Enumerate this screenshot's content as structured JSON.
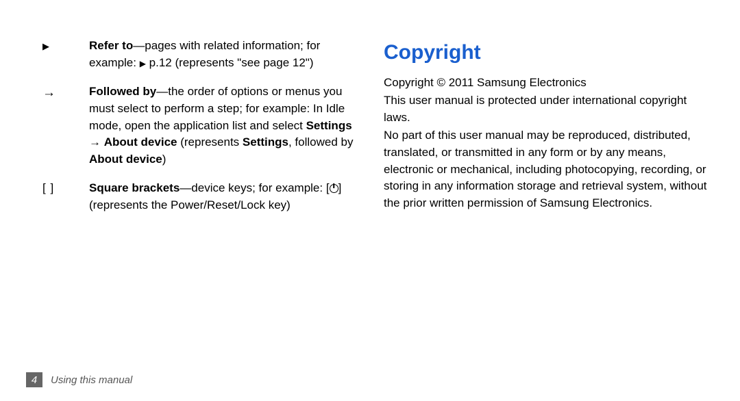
{
  "left": {
    "items": [
      {
        "symbol_type": "triangle",
        "term": "Refer to",
        "tail1": "—pages with related information; for example: ",
        "tail2": " p.12 (represents \"see page 12\")"
      },
      {
        "symbol_type": "arrow",
        "symbol": "→",
        "term": "Followed by",
        "tail1": "—the order of options or menus you must select to perform a step; for example: In Idle mode, open the application list and select ",
        "bold2a": "Settings",
        "mid1": " → ",
        "bold2b": "About device",
        "mid2": " (represents ",
        "bold2c": "Settings",
        "mid3": ", followed by ",
        "bold2d": "About device",
        "mid4": ")"
      },
      {
        "symbol_type": "brackets",
        "symbol": "[     ]",
        "term": "Square brackets",
        "tail1": "—device keys; for example: [",
        "tail2": "] (represents the Power/Reset/Lock key)"
      }
    ]
  },
  "right": {
    "heading": "Copyright",
    "line1": "Copyright © 2011 Samsung Electronics",
    "para1": "This user manual is protected under international copyright laws.",
    "para2": "No part of this user manual may be reproduced, distributed, translated, or transmitted in any form or by any means, electronic or mechanical, including photocopying, recording, or storing in any information storage and retrieval system, without the prior written permission of Samsung Electronics."
  },
  "footer": {
    "page": "4",
    "section": "Using this manual"
  }
}
